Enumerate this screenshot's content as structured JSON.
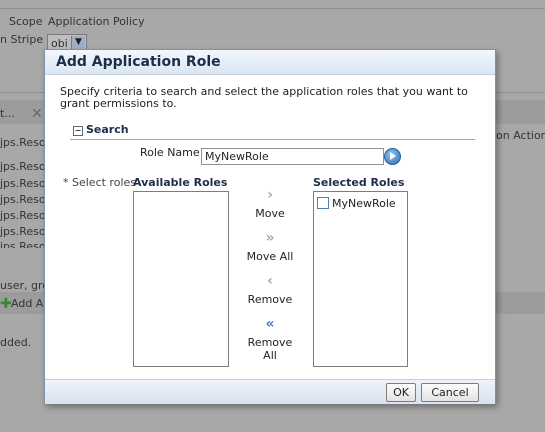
{
  "background": {
    "scope_label": "Scope",
    "scope_value": "Application Policy",
    "stripe_label": "n Stripe",
    "stripe_value": "obi",
    "toolbar_text": "t...",
    "actions_header": "on Actions",
    "rows": [
      "jps.Resou",
      "jps.Resou",
      "jps.Resou",
      "jps.Resou",
      "jps.Resou",
      "jps.Resou",
      "jps.Reso"
    ],
    "user_text": "user, gro",
    "add_text": "Add Ap",
    "added_text": "dded."
  },
  "dialog": {
    "title": "Add Application Role",
    "intro": "Specify criteria to search and select the application roles that you want to grant permissions to.",
    "search": {
      "section_label": "Search",
      "toggle_icon": "collapse-icon",
      "role_name_label": "Role Name",
      "role_name_value": "MyNewRole"
    },
    "select_roles_label": "* Select roles",
    "available_header": "Available Roles",
    "selected_header": "Selected Roles",
    "available_items": [],
    "selected_items": [
      "MyNewRole"
    ],
    "shuttle": {
      "move": "Move",
      "move_all": "Move All",
      "remove": "Remove",
      "remove_all": "Remove All"
    },
    "ok": "OK",
    "cancel": "Cancel",
    "accent_color": "#3b7bd1"
  }
}
